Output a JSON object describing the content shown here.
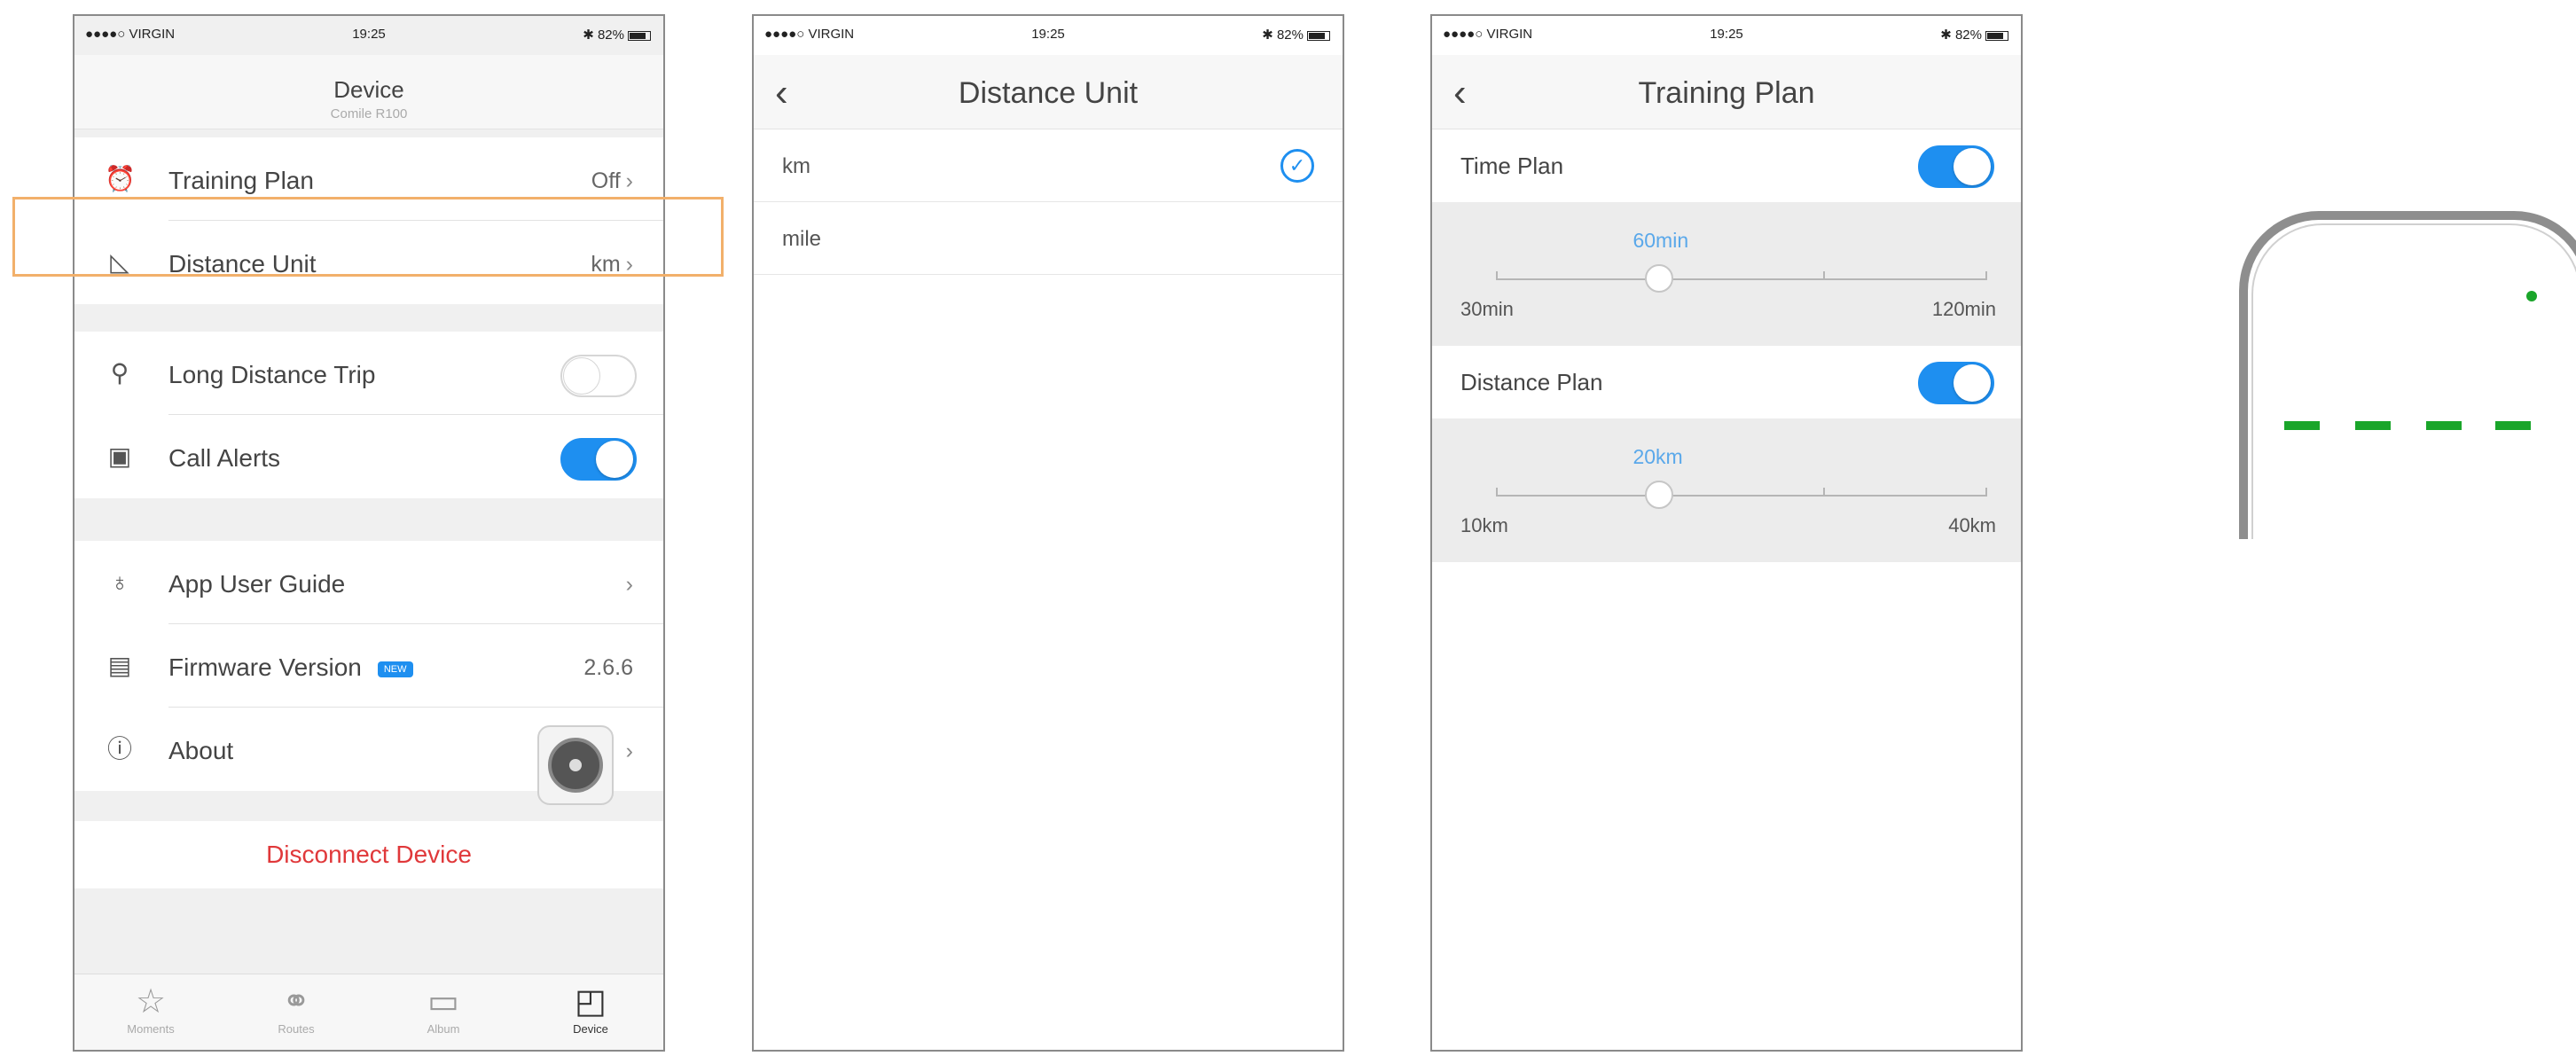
{
  "status_bar": {
    "carrier": "●●●●○ VIRGIN",
    "time": "19:25",
    "battery": "82%"
  },
  "screen1": {
    "title": "Device",
    "subtitle": "Comile R100",
    "group1": [
      {
        "icon": "alarm-clock-icon",
        "label": "Training Plan",
        "value": "Off"
      },
      {
        "icon": "ruler-icon",
        "label": "Distance Unit",
        "value": "km"
      }
    ],
    "group2": [
      {
        "icon": "route-icon",
        "label": "Long Distance Trip",
        "toggle": false
      },
      {
        "icon": "phone-alert-icon",
        "label": "Call Alerts",
        "toggle": true
      }
    ],
    "group3": [
      {
        "icon": "lightbulb-icon",
        "label": "App User Guide",
        "value": ""
      },
      {
        "icon": "firmware-icon",
        "label": "Firmware Version",
        "badge": "NEW",
        "value": "2.6.6"
      },
      {
        "icon": "info-icon",
        "label": "About",
        "value": ""
      }
    ],
    "disconnect_label": "Disconnect Device",
    "tabs": [
      {
        "icon": "star-icon",
        "label": "Moments",
        "active": false
      },
      {
        "icon": "bicycle-icon",
        "label": "Routes",
        "active": false
      },
      {
        "icon": "album-icon",
        "label": "Album",
        "active": false
      },
      {
        "icon": "device-icon",
        "label": "Device",
        "active": true
      }
    ]
  },
  "screen2": {
    "title": "Distance Unit",
    "options": [
      {
        "label": "km",
        "selected": true
      },
      {
        "label": "mile",
        "selected": false
      }
    ]
  },
  "screen3": {
    "title": "Training Plan",
    "time_plan": {
      "label": "Time Plan",
      "enabled": true,
      "value": "60min",
      "min": "30min",
      "max": "120min",
      "fraction": 0.333
    },
    "distance_plan": {
      "label": "Distance Plan",
      "enabled": true,
      "value": "20km",
      "min": "10km",
      "max": "40km",
      "fraction": 0.333
    }
  },
  "colors": {
    "accent": "#1e8ff0",
    "danger": "#e0383a",
    "highlight": "#f2b06b",
    "indicator": "#1aa52a"
  }
}
